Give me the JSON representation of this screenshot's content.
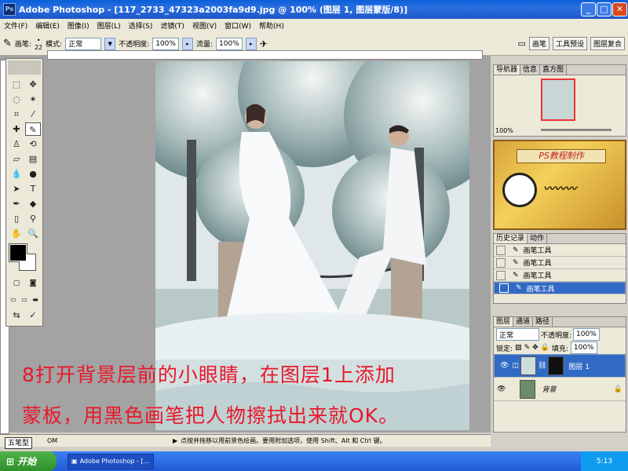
{
  "window": {
    "title": "Adobe Photoshop - [117_2733_47323a2003fa9d9.jpg @ 100% (图层 1, 图层蒙版/8)]"
  },
  "menu": [
    "文件(F)",
    "编辑(E)",
    "图像(I)",
    "图层(L)",
    "选择(S)",
    "滤镜(T)",
    "视图(V)",
    "窗口(W)",
    "帮助(H)"
  ],
  "options": {
    "brush_label": "画笔:",
    "brush_size": "22",
    "mode_label": "模式:",
    "mode_value": "正常",
    "opacity_label": "不透明度:",
    "opacity_value": "100%",
    "flow_label": "流量:",
    "flow_value": "100%",
    "palette_tabs": [
      "画笔",
      "工具预设",
      "图层复合"
    ]
  },
  "caption": {
    "line1": "8打开背景层前的小眼睛，在图层1上添加",
    "line2": "蒙板，用黑色画笔把人物擦拭出来就OK。"
  },
  "statusbar": {
    "zoom": "OM",
    "hint": "点按并拖移以用前景色绘画。要用附加选项，使用 Shift、Alt 和 Ctrl 键。"
  },
  "navigator": {
    "tabs": [
      "导航器",
      "信息",
      "直方图"
    ],
    "zoom": "100%"
  },
  "badge": {
    "title": "PS教程制作"
  },
  "history": {
    "tabs": [
      "历史记录",
      "动作"
    ],
    "items": [
      "画笔工具",
      "画笔工具",
      "画笔工具",
      "画笔工具"
    ]
  },
  "layers": {
    "tabs": [
      "图层",
      "通道",
      "路径"
    ],
    "blend": "正常",
    "opacity_label": "不透明度:",
    "opacity_value": "100%",
    "lock_label": "锁定:",
    "fill_label": "填充:",
    "fill_value": "100%",
    "items": [
      "图层 1",
      "背景"
    ]
  },
  "taskbar": {
    "start": "开始",
    "task": "Adobe Photoshop - [...",
    "clock": "5:13",
    "ime": "五笔型"
  },
  "colors": {
    "caption": "#e8182a",
    "selection": "#316ac5"
  }
}
